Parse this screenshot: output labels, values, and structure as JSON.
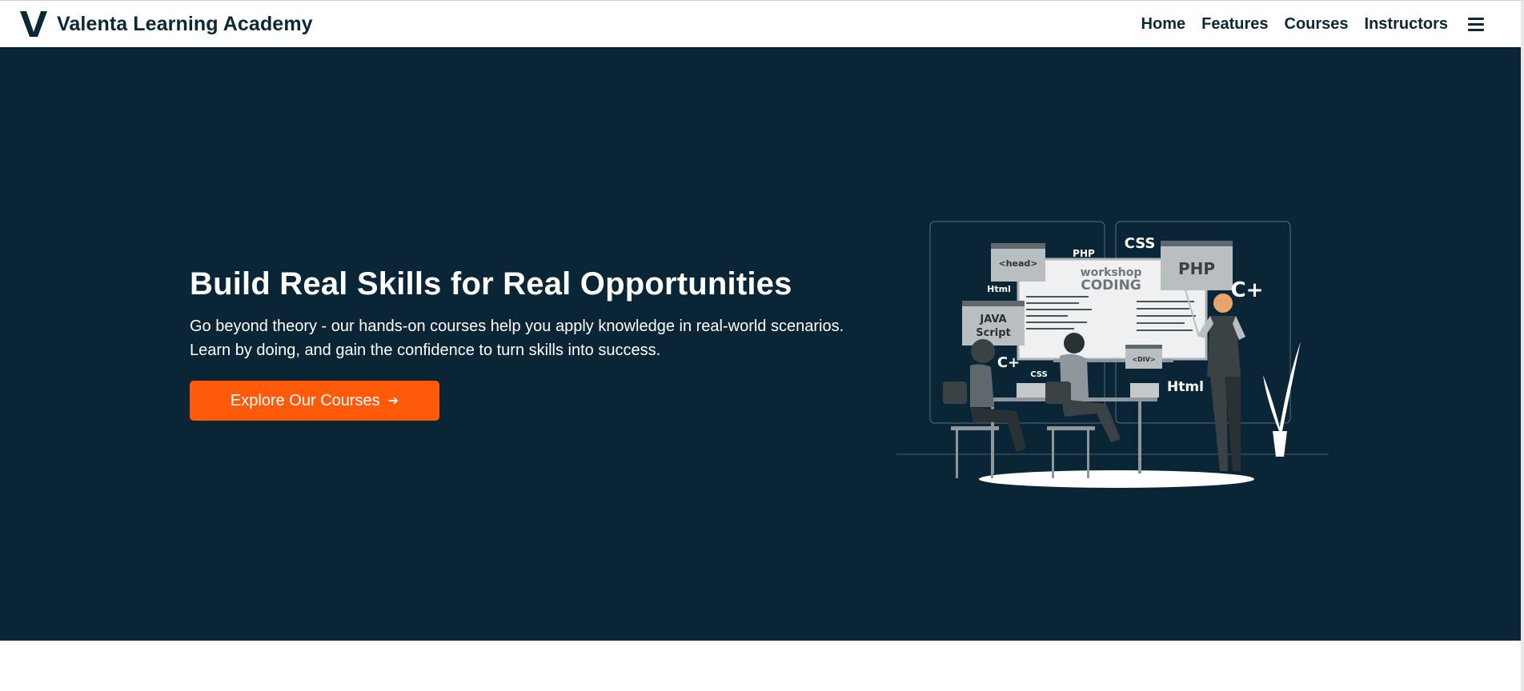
{
  "brand": {
    "name": "Valenta Learning Academy",
    "logo_icon": "v-logo-icon"
  },
  "nav": {
    "links": [
      "Home",
      "Features",
      "Courses",
      "Instructors"
    ],
    "menu_icon": "hamburger-menu-icon"
  },
  "hero": {
    "title": "Build Real Skills for Real Opportunities",
    "description": "Go beyond theory - our hands-on courses help you apply knowledge in real-world scenarios. Learn by doing, and gain the confidence to turn skills into success.",
    "cta_label": "Explore Our Courses",
    "cta_icon": "arrow-right-icon"
  },
  "illustration": {
    "board_line1": "workshop",
    "board_line2": "CODING",
    "tags": {
      "php_small": "PHP",
      "css_top": "CSS",
      "php_big": "PHP",
      "c_plus_right": "C+",
      "head": "<head>",
      "html_small": "Html",
      "java": "JAVA",
      "script": "Script",
      "c_plus_left": "C+",
      "div": "<DIV>",
      "css_small": "CSS",
      "html_big": "Html"
    }
  },
  "colors": {
    "hero_bg": "#0a2535",
    "accent": "#ff5a0a",
    "brand_text": "#0c2736"
  }
}
